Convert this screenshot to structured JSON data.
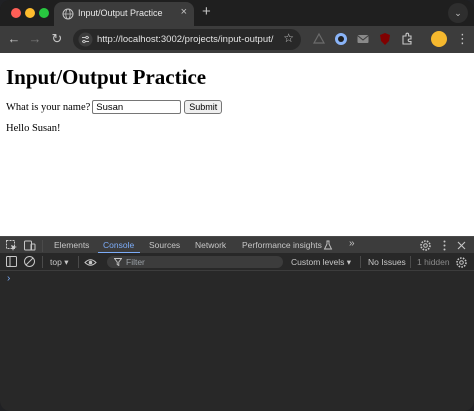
{
  "tab": {
    "title": "Input/Output Practice",
    "close_icon": "×",
    "new_tab_icon": "+",
    "search_icon": "⌄"
  },
  "toolbar": {
    "back_icon": "←",
    "forward_icon": "→",
    "reload_icon": "↻",
    "url": "http://localhost:3002/projects/input-output/",
    "star_icon": "☆",
    "menu_icon": "⋮"
  },
  "page": {
    "heading": "Input/Output Practice",
    "prompt_label": "What is your name?",
    "name_value": "Susan",
    "submit_label": "Submit",
    "greeting": "Hello Susan!"
  },
  "devtools": {
    "tabs": [
      "Elements",
      "Console",
      "Sources",
      "Network",
      "Performance insights"
    ],
    "more_tabs": "»",
    "context": "top",
    "filter_placeholder": "Filter",
    "levels": "Custom levels",
    "issues": "No Issues",
    "hidden": "1 hidden",
    "console_prompt": "›",
    "dropdown_arrow": "▾"
  },
  "colors": {
    "accent": "#7cacf8",
    "close": "#ff5f57",
    "minimize": "#febc2e",
    "maximize": "#28c840"
  }
}
